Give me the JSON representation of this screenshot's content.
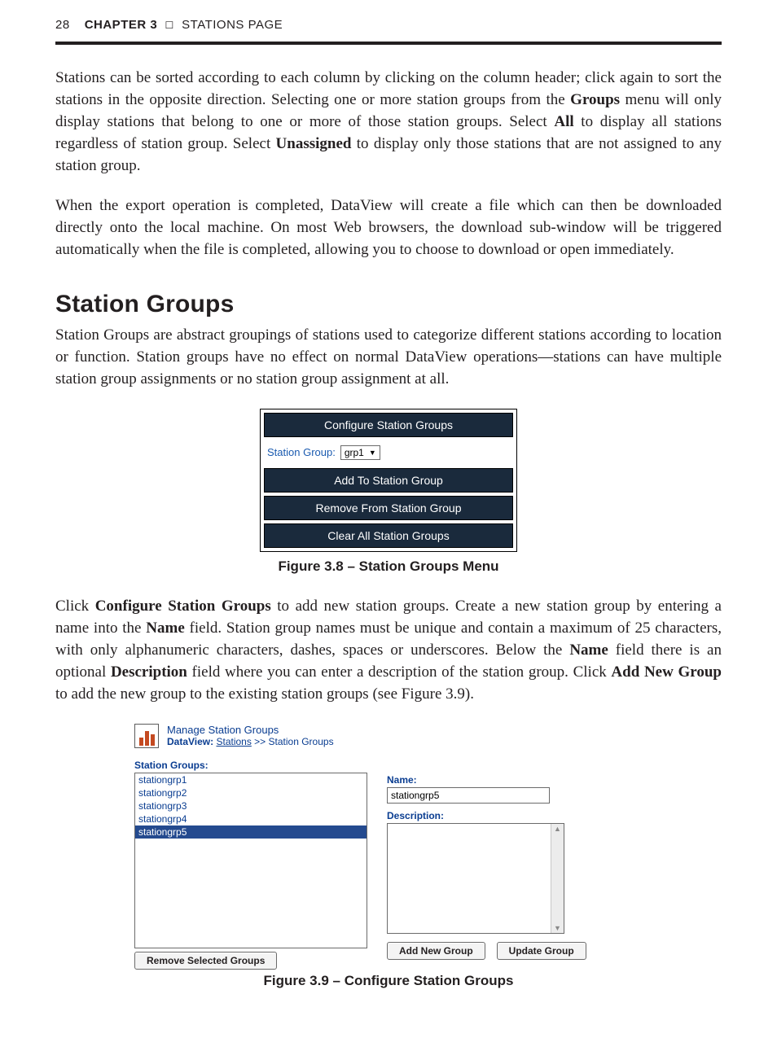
{
  "header": {
    "page_number": "28",
    "chapter_label": "CHAPTER 3",
    "square": "☐",
    "section_label": "STATIONS PAGE"
  },
  "paragraphs": {
    "p1_a": "Stations can be sorted according to each column by clicking on the column header; click again to sort the stations in the opposite direction. Selecting one or more station groups from the ",
    "p1_b_strong": "Groups",
    "p1_c": " menu will only display stations that belong to one or more of those station groups. Select ",
    "p1_d_strong": "All",
    "p1_e": " to display all stations regardless of station group. Select ",
    "p1_f_strong": "Unassigned",
    "p1_g": " to display only those stations that are not assigned to any station group.",
    "p2": "When the export operation is completed, DataView will create a file which can then be downloaded directly onto the local machine. On most Web browsers, the download sub-window will be triggered automatically when the file is completed, allowing you to choose to download or open immediately.",
    "p3": "Station Groups are abstract groupings of stations used to categorize different stations according to location or function. Station groups have no effect on normal DataView operations—stations can have multiple station group assignments or no station group assignment at all.",
    "p4_a": "Click ",
    "p4_b_strong": "Configure Station Groups",
    "p4_c": " to add new station groups. Create a new station group by entering a name into the ",
    "p4_d_strong": "Name",
    "p4_e": " field. Station group names must be unique and contain a maximum of 25 characters, with only alphanumeric characters, dashes, spaces or underscores. Below the ",
    "p4_f_strong": "Name",
    "p4_g": " field there is an optional ",
    "p4_h_strong": "Description",
    "p4_i": " field where you can enter a description of the station group. Click ",
    "p4_j_strong": "Add New Group",
    "p4_k": " to add the new group to the existing station groups (see Figure 3.9)."
  },
  "section_title": "Station Groups",
  "fig38": {
    "configure": "Configure Station Groups",
    "station_group_label": "Station Group:",
    "select_value": "grp1",
    "add": "Add To Station Group",
    "remove": "Remove From Station Group",
    "clear": "Clear All Station Groups",
    "caption": "Figure 3.8 – Station Groups Menu"
  },
  "fig39": {
    "title": "Manage Station Groups",
    "breadcrumb_app": "DataView:",
    "breadcrumb_link": "Stations",
    "breadcrumb_tail": " >> Station Groups",
    "sg_label": "Station Groups:",
    "items": [
      "stationgrp1",
      "stationgrp2",
      "stationgrp3",
      "stationgrp4",
      "stationgrp5"
    ],
    "selected_index": 4,
    "name_label": "Name:",
    "name_value": "stationgrp5",
    "desc_label": "Description:",
    "add_btn": "Add New Group",
    "update_btn": "Update Group",
    "remove_btn": "Remove Selected Groups",
    "caption": "Figure 3.9 – Configure Station Groups"
  }
}
